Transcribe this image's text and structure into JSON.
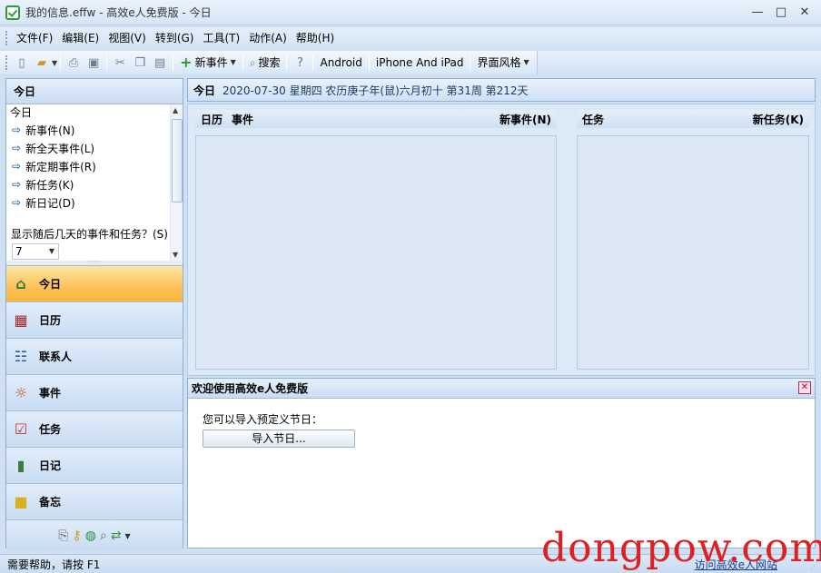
{
  "window": {
    "title": "我的信息.effw - 高效e人免费版 - 今日",
    "min": "—",
    "max": "□",
    "close": "✕"
  },
  "menu": [
    "文件(F)",
    "编辑(E)",
    "视图(V)",
    "转到(G)",
    "工具(T)",
    "动作(A)",
    "帮助(H)"
  ],
  "toolbar": {
    "new_event": "新事件",
    "search": "搜索",
    "android": "Android",
    "iphone": "iPhone And iPad",
    "style": "界面风格"
  },
  "left": {
    "header": "今日",
    "sub": "今日",
    "links": [
      "新事件(N)",
      "新全天事件(L)",
      "新定期事件(R)",
      "新任务(K)",
      "新日记(D)"
    ],
    "days_label": "显示随后几天的事件和任务？(S)",
    "days_value": "7",
    "nav": [
      "今日",
      "日历",
      "联系人",
      "事件",
      "任务",
      "日记",
      "备忘"
    ]
  },
  "main": {
    "title": "今日",
    "date": "2020-07-30 星期四  农历庚子年(鼠)六月初十   第31周  第212天",
    "cal_col": "日历",
    "event_col": "事件",
    "new_event": "新事件(N)",
    "task_col": "任务",
    "new_task": "新任务(K)"
  },
  "welcome": {
    "title": "欢迎使用高效e人免费版",
    "text": "您可以导入预定义节日：",
    "button": "导入节日..."
  },
  "status": {
    "help": "需要帮助，请按 F1",
    "link": "访问高效e人网站"
  },
  "watermark": "dongpow.com"
}
